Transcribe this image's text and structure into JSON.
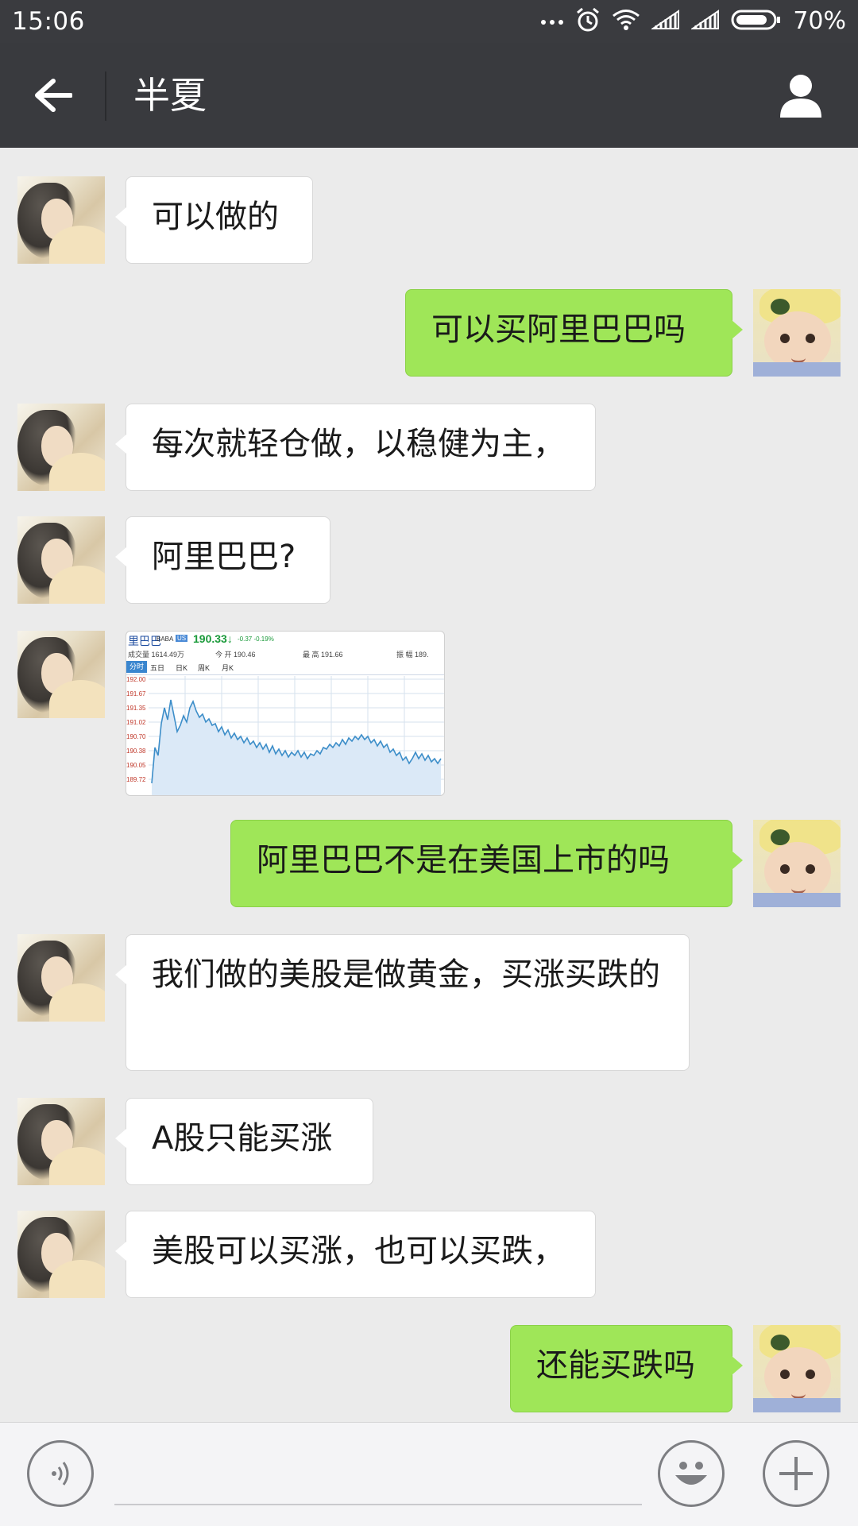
{
  "status_bar": {
    "time": "15:06",
    "battery": "70%"
  },
  "header": {
    "title": "半夏",
    "back_icon": "back-arrow-icon",
    "profile_icon": "person-icon"
  },
  "colors": {
    "header_bg": "#393a3e",
    "chat_bg": "#ebebeb",
    "bubble_out": "#9fe658",
    "bubble_in": "#ffffff"
  },
  "messages": [
    {
      "side": "in",
      "text": "可以做的"
    },
    {
      "side": "out",
      "text": "可以买阿里巴巴吗"
    },
    {
      "side": "in",
      "text": "每次就轻仓做，以稳健为主，"
    },
    {
      "side": "in",
      "text": "阿里巴巴?"
    },
    {
      "side": "in",
      "type": "image",
      "text": ""
    },
    {
      "side": "out",
      "text": "阿里巴巴不是在美国上市的吗"
    },
    {
      "side": "in",
      "text": "我们做的美股是做黄金，买涨买跌的"
    },
    {
      "side": "in",
      "text": "A股只能买涨"
    },
    {
      "side": "in",
      "text": "美股可以买涨，也可以买跌，"
    },
    {
      "side": "out",
      "text": "还能买跌吗"
    }
  ],
  "stock_image": {
    "name": "里巴巴",
    "code": "BABA",
    "tag": "US",
    "price": "190.33",
    "arrow": "↓",
    "change": "-0.37  -0.19%",
    "volume": "成交量 1614.49万",
    "open": "今 开 190.46",
    "high": "最 高 191.66",
    "amplitude": "振 幅 189.",
    "tabs": [
      "分时",
      "五日",
      "日K",
      "周K",
      "月K"
    ],
    "y_ticks": [
      "192.00",
      "191.67",
      "191.35",
      "191.02",
      "190.70",
      "190.38",
      "190.05",
      "189.72"
    ]
  },
  "input_bar": {
    "placeholder": "",
    "voice_icon": "voice-icon",
    "emoji_icon": "emoji-icon",
    "plus_icon": "plus-icon"
  }
}
